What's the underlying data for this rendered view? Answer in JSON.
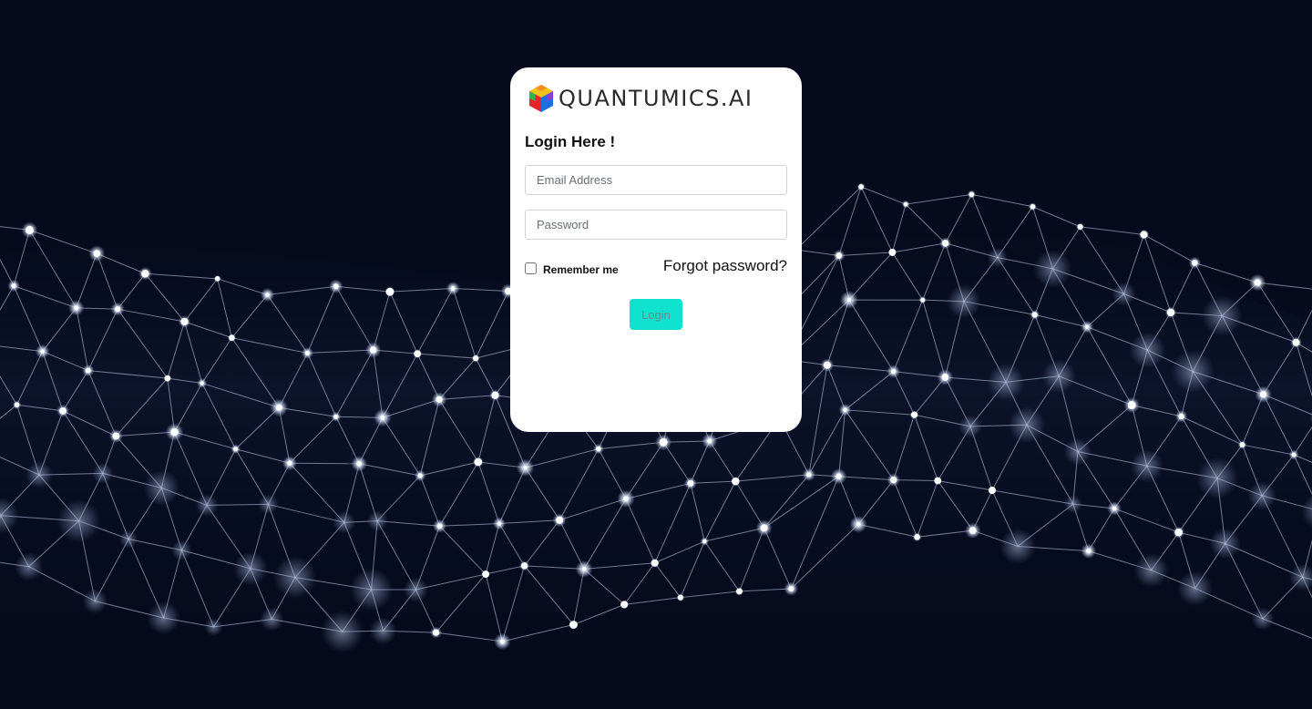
{
  "brand": {
    "name": "QUANTUMICS.AI",
    "logo_icon": "cube-logo-icon"
  },
  "login": {
    "title": "Login Here !",
    "email_placeholder": "Email Address",
    "password_placeholder": "Password",
    "remember_label": "Remember me",
    "remember_checked": false,
    "forgot_label": "Forgot password?",
    "submit_label": "Login"
  },
  "colors": {
    "background": "#050a1c",
    "accent_button": "#0fe3cf",
    "card": "#ffffff"
  }
}
